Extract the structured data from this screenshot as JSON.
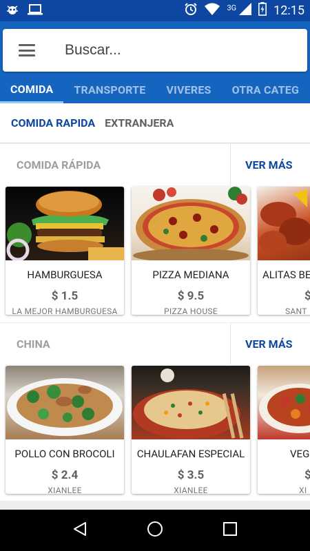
{
  "status_bar": {
    "left_icons": [
      "bug-icon",
      "laptop-icon"
    ],
    "network": "3G",
    "time": "12:15"
  },
  "search": {
    "placeholder": "Buscar..."
  },
  "tabs": [
    {
      "label": "COMIDA",
      "active": true
    },
    {
      "label": "TRANSPORTE",
      "active": false
    },
    {
      "label": "VIVERES",
      "active": false
    },
    {
      "label": "OTRA CATEG",
      "active": false
    }
  ],
  "subtabs": [
    {
      "label": "COMIDA RAPIDA",
      "active": true
    },
    {
      "label": "EXTRANJERA",
      "active": false
    }
  ],
  "sections": [
    {
      "title": "COMIDA RÁPIDA",
      "more": "VER MÁS",
      "items": [
        {
          "name": "HAMBURGUESA",
          "price": "$ 1.5",
          "store": "LA MEJOR HAMBURGUESA"
        },
        {
          "name": "PIZZA MEDIANA",
          "price": "$ 9.5",
          "store": "PIZZA HOUSE"
        },
        {
          "name": "ALITAS BE",
          "price": "$",
          "store": "SANT"
        }
      ]
    },
    {
      "title": "CHINA",
      "more": "VER MÁS",
      "items": [
        {
          "name": "POLLO CON BROCOLI",
          "price": "$ 2.4",
          "store": "XIANLEE"
        },
        {
          "name": "CHAULAFAN ESPECIAL",
          "price": "$ 3.5",
          "store": "XIANLEE"
        },
        {
          "name": "VEG",
          "price": "$",
          "store": "XI"
        }
      ]
    }
  ],
  "colors": {
    "status_bar": "#0d47a1",
    "app_bar": "#1565c0",
    "accent": "#0d47a1"
  }
}
